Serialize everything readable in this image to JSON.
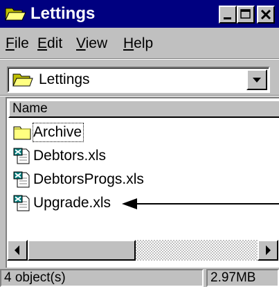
{
  "window": {
    "title": "Lettings",
    "controls": {
      "minimize": "minimize-icon",
      "maximize": "maximize-icon",
      "close": "close-icon"
    }
  },
  "menu": {
    "items": [
      {
        "label": "File",
        "accel": "F"
      },
      {
        "label": "Edit",
        "accel": "E"
      },
      {
        "label": "View",
        "accel": "V"
      },
      {
        "label": "Help",
        "accel": "H"
      }
    ]
  },
  "address": {
    "value": "Lettings",
    "icon": "folder-icon"
  },
  "list": {
    "column_header": "Name",
    "items": [
      {
        "name": "Archive",
        "icon": "folder-icon",
        "focused": true
      },
      {
        "name": "Debtors.xls",
        "icon": "excel-file-icon"
      },
      {
        "name": "DebtorsProgs.xls",
        "icon": "excel-file-icon"
      },
      {
        "name": "Upgrade.xls",
        "icon": "excel-file-icon"
      }
    ]
  },
  "status": {
    "objects": "4 object(s)",
    "size": "2.97MB"
  },
  "colors": {
    "titlebar": "#000080",
    "face": "#c0c0c0",
    "folder": "#ffff80"
  }
}
